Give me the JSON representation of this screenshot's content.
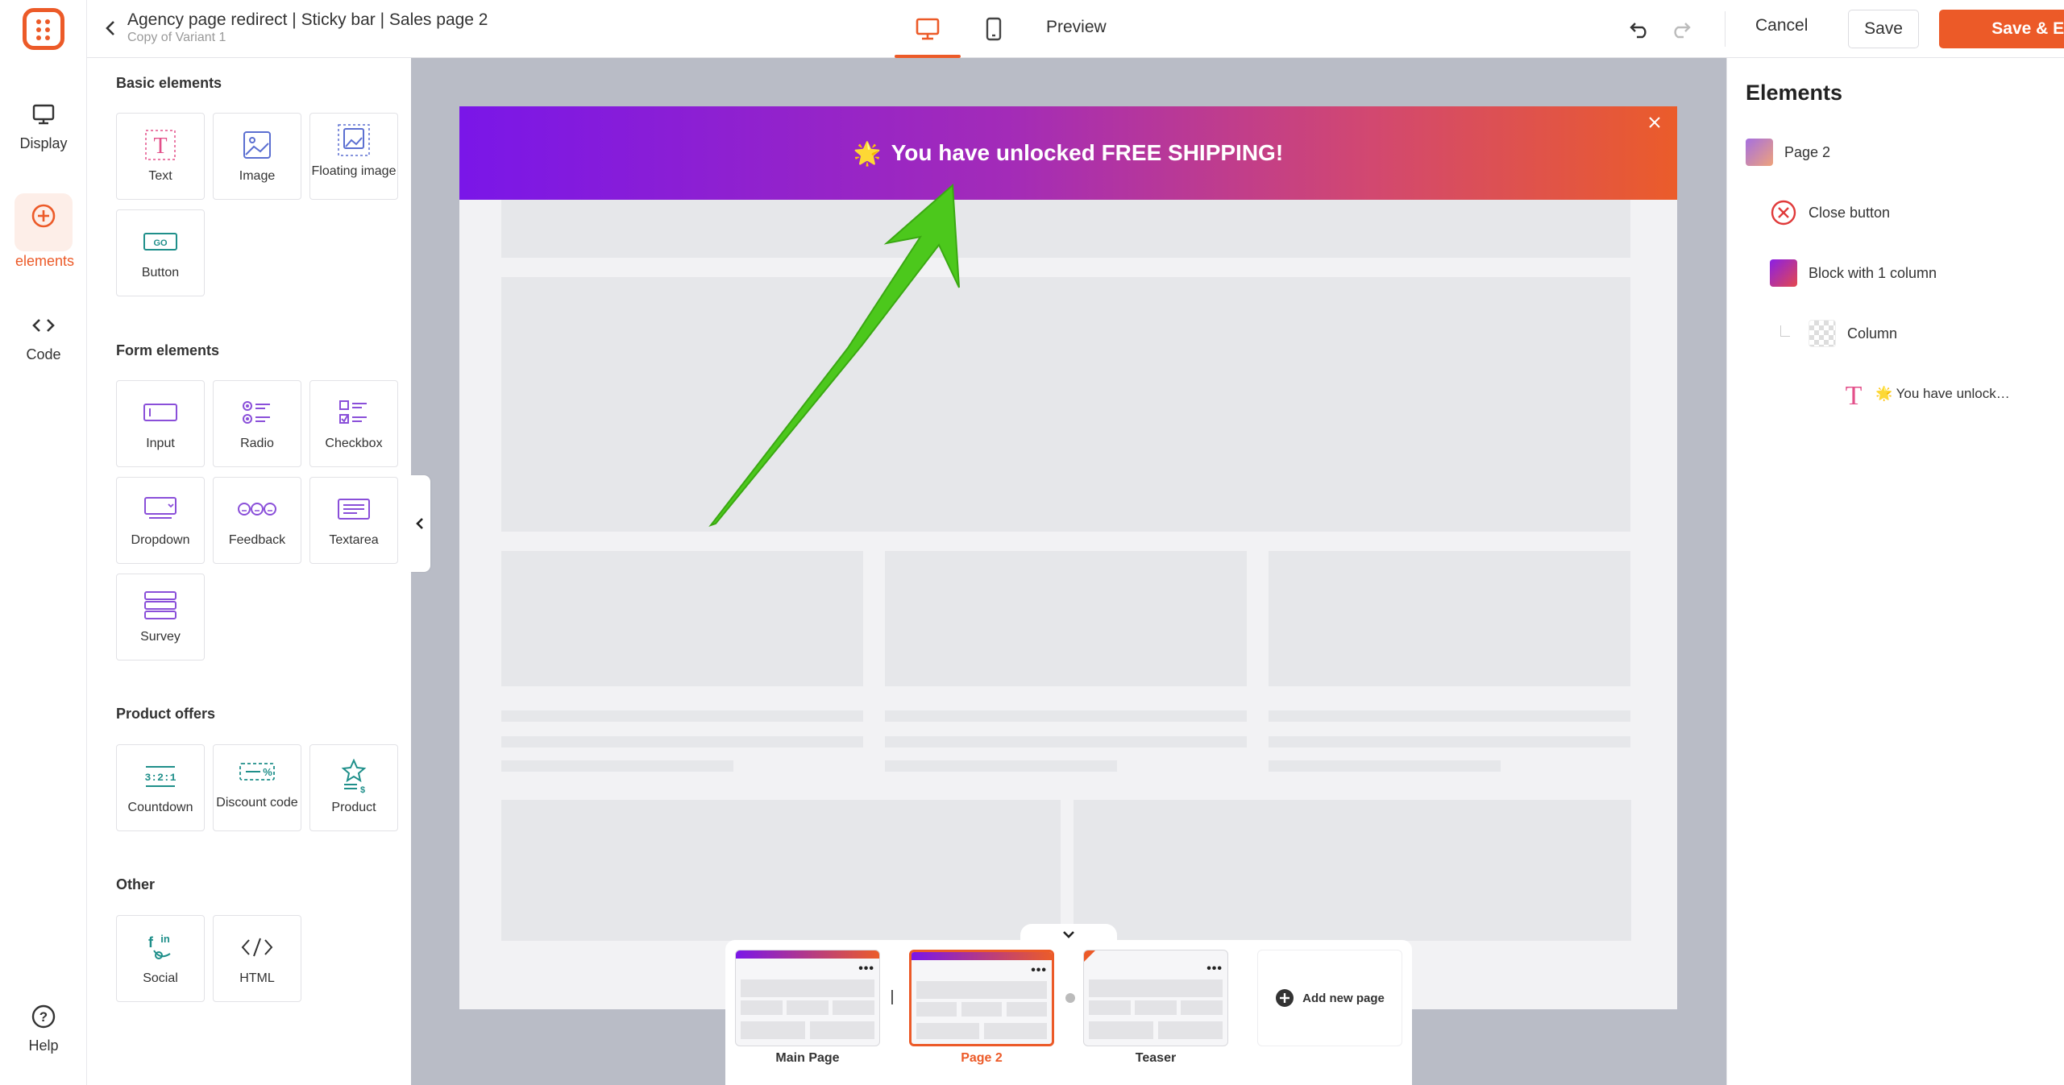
{
  "header": {
    "title": "Agency page redirect | Sticky bar | Sales page 2",
    "subtitle": "Copy of Variant 1",
    "preview_label": "Preview",
    "cancel_label": "Cancel",
    "save_label": "Save",
    "save_exit_label": "Save & Exit"
  },
  "rail": {
    "display_label": "Display",
    "add_elements_label": "Add elements",
    "code_label": "Code",
    "help_label": "Help"
  },
  "panel": {
    "basic": {
      "title": "Basic elements",
      "items": [
        {
          "label": "Text",
          "icon": "text-icon"
        },
        {
          "label": "Image",
          "icon": "image-icon"
        },
        {
          "label": "Floating image",
          "icon": "floating-image-icon"
        },
        {
          "label": "Button",
          "icon": "button-icon"
        }
      ]
    },
    "form": {
      "title": "Form elements",
      "items": [
        {
          "label": "Input",
          "icon": "input-icon"
        },
        {
          "label": "Radio",
          "icon": "radio-icon"
        },
        {
          "label": "Checkbox",
          "icon": "checkbox-icon"
        },
        {
          "label": "Dropdown",
          "icon": "dropdown-icon"
        },
        {
          "label": "Feedback",
          "icon": "feedback-icon"
        },
        {
          "label": "Textarea",
          "icon": "textarea-icon"
        },
        {
          "label": "Survey",
          "icon": "survey-icon"
        }
      ]
    },
    "product": {
      "title": "Product offers",
      "items": [
        {
          "label": "Countdown",
          "icon": "countdown-icon"
        },
        {
          "label": "Discount code",
          "icon": "discount-code-icon"
        },
        {
          "label": "Product",
          "icon": "product-icon"
        }
      ]
    },
    "other": {
      "title": "Other",
      "items": [
        {
          "label": "Social",
          "icon": "social-icon"
        },
        {
          "label": "HTML",
          "icon": "html-icon"
        }
      ]
    },
    "button_icon_text": "GO",
    "countdown_icon_text": "3:2:1"
  },
  "canvas": {
    "sticky_bar_text": "You have unlocked FREE SHIPPING!",
    "sticky_bar_emoji": "🌟"
  },
  "pages": [
    {
      "label": "Main Page",
      "active": false
    },
    {
      "label": "Page 2",
      "active": true
    },
    {
      "label": "Teaser",
      "active": false
    }
  ],
  "add_page_label": "Add new page",
  "elements_panel": {
    "title": "Elements",
    "tree": [
      {
        "label": "Page 2",
        "level": 0
      },
      {
        "label": "Close button",
        "level": 1
      },
      {
        "label": "Block with 1 column",
        "level": 1
      },
      {
        "label": "Column",
        "level": 2
      },
      {
        "label": "🌟 You have unlock…",
        "level": 3
      }
    ]
  },
  "colors": {
    "accent": "#ec5a28",
    "bar_start": "#7a16e8",
    "bar_end": "#eb5c2a",
    "canvas_bg": "#b9bcc6",
    "arrow": "#4cc81c"
  }
}
